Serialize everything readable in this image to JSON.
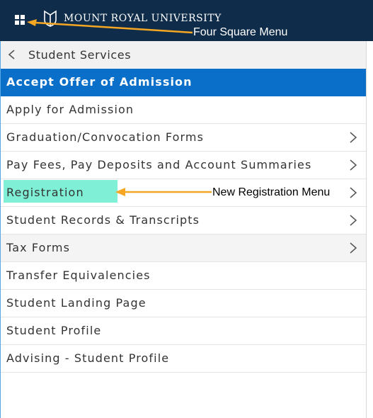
{
  "header": {
    "brand": "MOUNT ROYAL UNIVERSITY",
    "menu_icon": "four-square-grid-icon",
    "logo_icon": "university-crest-icon",
    "background": "#0f2d4a"
  },
  "nav": {
    "back_icon": "chevron-left-icon",
    "title": "Student Services"
  },
  "menu": {
    "items": [
      {
        "label": "Accept Offer of Admission",
        "active": true,
        "has_chevron": false
      },
      {
        "label": "Apply for Admission",
        "active": false,
        "has_chevron": false
      },
      {
        "label": "Graduation/Convocation Forms",
        "active": false,
        "has_chevron": true
      },
      {
        "label": "Pay Fees, Pay Deposits and Account Summaries",
        "active": false,
        "has_chevron": true
      },
      {
        "label": "Registration",
        "active": false,
        "has_chevron": true
      },
      {
        "label": "Student Records & Transcripts",
        "active": false,
        "has_chevron": true
      },
      {
        "label": "Tax Forms",
        "active": false,
        "has_chevron": true
      },
      {
        "label": "Transfer Equivalencies",
        "active": false,
        "has_chevron": false
      },
      {
        "label": "Student Landing Page",
        "active": false,
        "has_chevron": false
      },
      {
        "label": "Student Profile",
        "active": false,
        "has_chevron": false
      },
      {
        "label": "Advising - Student Profile",
        "active": false,
        "has_chevron": false
      }
    ],
    "active_color": "#0a6fc9",
    "chevron_icon": "chevron-right-icon"
  },
  "annotations": {
    "four_square": "Four Square Menu",
    "new_registration": "New Registration Menu",
    "highlight_color": "#7ff0d6",
    "arrow_color": "#f5a623"
  }
}
